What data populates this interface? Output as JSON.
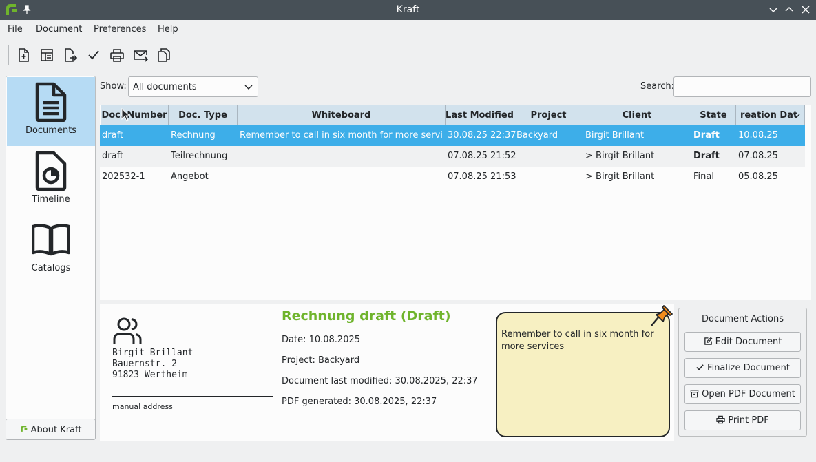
{
  "window": {
    "title": "Kraft"
  },
  "menu": {
    "file": "File",
    "document": "Document",
    "preferences": "Preferences",
    "help": "Help"
  },
  "sidebar": {
    "items": [
      {
        "label": "Documents"
      },
      {
        "label": "Timeline"
      },
      {
        "label": "Catalogs"
      }
    ],
    "about_label": "About Kraft"
  },
  "filter": {
    "show_label": "Show:",
    "show_value": "All documents",
    "search_label": "Search:",
    "search_value": ""
  },
  "table": {
    "columns": [
      "Doc. Number",
      "Doc. Type",
      "Whiteboard",
      "Last Modified",
      "Project",
      "Client",
      "State",
      "reation Dat"
    ],
    "rows": [
      {
        "number": "draft",
        "type": "Rechnung",
        "whiteboard": "Remember to call in six month for more services",
        "modified": "30.08.25 22:37",
        "project": "Backyard",
        "client": "Birgit Brillant",
        "state": "Draft",
        "created": "10.08.25"
      },
      {
        "number": "draft",
        "type": "Teilrechnung",
        "whiteboard": "",
        "modified": "07.08.25 21:52",
        "project": "",
        "client": "> Birgit Brillant",
        "state": "Draft",
        "created": "07.08.25"
      },
      {
        "number": "202532-1",
        "type": "Angebot",
        "whiteboard": "",
        "modified": "07.08.25 21:53",
        "project": "",
        "client": "> Birgit Brillant",
        "state": "Final",
        "created": "05.08.25"
      }
    ]
  },
  "details": {
    "address": [
      "Birgit Brillant",
      "Bauernstr. 2",
      "91823 Wertheim"
    ],
    "address_note": "manual address",
    "title": "Rechnung draft (Draft)",
    "date": "Date: 10.08.2025",
    "project": "Project: Backyard",
    "last_modified": "Document last modified: 30.08.2025, 22:37",
    "pdf_generated": "PDF generated: 30.08.2025, 22:37",
    "note": "Remember to call in six month for more services"
  },
  "actions": {
    "title": "Document Actions",
    "edit": "Edit Document",
    "finalize": "Finalize Document",
    "open_pdf": "Open PDF Document",
    "print_pdf": "Print PDF"
  },
  "colors": {
    "accent": "#3daee9",
    "title_green": "#6fb42c",
    "note_bg": "#f7f0c2",
    "titlebar": "#475057"
  }
}
